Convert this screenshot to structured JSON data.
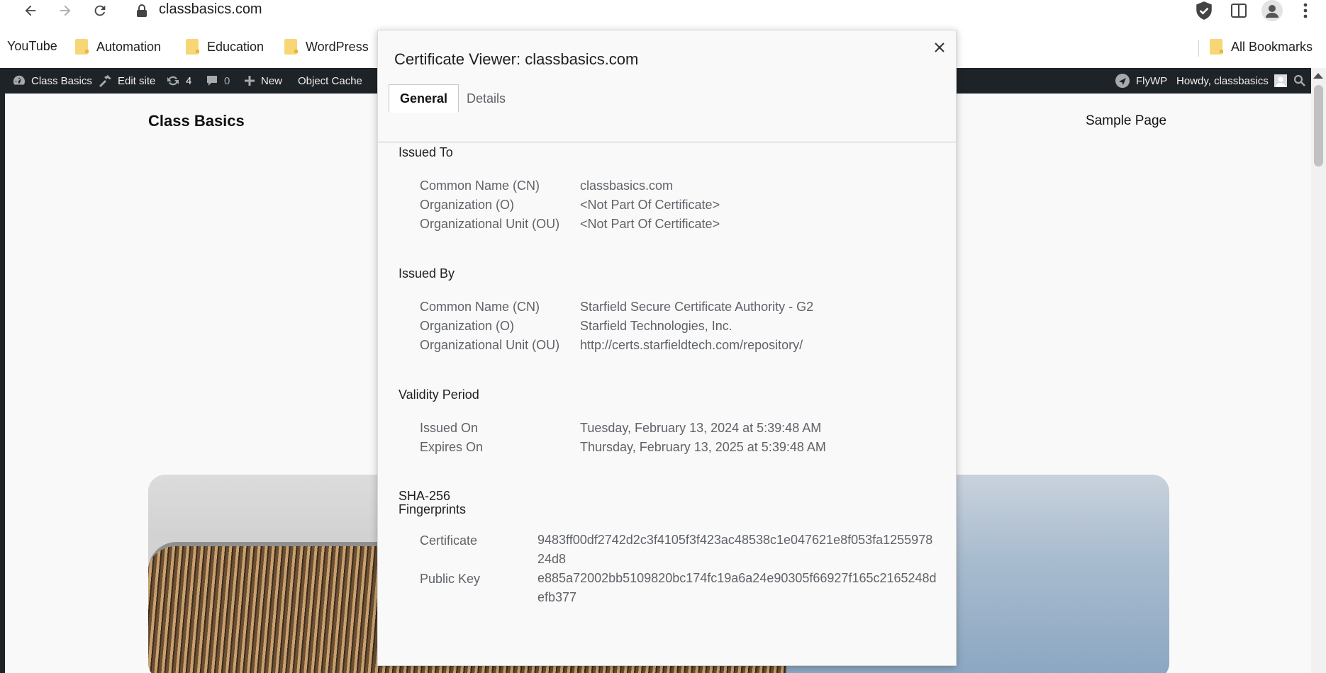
{
  "browser": {
    "url": "classbasics.com",
    "bookmarks": [
      {
        "label": "YouTube",
        "folder": false
      },
      {
        "label": "Automation",
        "folder": true
      },
      {
        "label": "Education",
        "folder": true
      },
      {
        "label": "WordPress",
        "folder": true
      }
    ],
    "all_bookmarks": "All Bookmarks"
  },
  "adminbar": {
    "site_name": "Class Basics",
    "edit_site": "Edit site",
    "updates_count": "4",
    "comments_count": "0",
    "new_label": "New",
    "object_cache": "Object Cache",
    "flywp": "FlyWP",
    "howdy": "Howdy, classbasics"
  },
  "site": {
    "title": "Class Basics",
    "nav_sample_page": "Sample Page"
  },
  "dialog": {
    "title": "Certificate Viewer: classbasics.com",
    "tabs": {
      "general": "General",
      "details": "Details"
    },
    "issued_to": {
      "heading": "Issued To",
      "cn_label": "Common Name (CN)",
      "cn_value": "classbasics.com",
      "o_label": "Organization (O)",
      "o_value": "<Not Part Of Certificate>",
      "ou_label": "Organizational Unit (OU)",
      "ou_value": "<Not Part Of Certificate>"
    },
    "issued_by": {
      "heading": "Issued By",
      "cn_label": "Common Name (CN)",
      "cn_value": "Starfield Secure Certificate Authority - G2",
      "o_label": "Organization (O)",
      "o_value": "Starfield Technologies, Inc.",
      "ou_label": "Organizational Unit (OU)",
      "ou_value": "http://certs.starfieldtech.com/repository/"
    },
    "validity": {
      "heading": "Validity Period",
      "issued_label": "Issued On",
      "issued_value": "Tuesday, February 13, 2024 at 5:39:48 AM",
      "expires_label": "Expires On",
      "expires_value": "Thursday, February 13, 2025 at 5:39:48 AM"
    },
    "fingerprints": {
      "heading_line1": "SHA-256",
      "heading_line2": "Fingerprints",
      "cert_label": "Certificate",
      "cert_value": "9483ff00df2742d2c3f4105f3f423ac48538c1e047621e8f053fa125597824d8",
      "pubkey_label": "Public Key",
      "pubkey_value": "e885a72002bb5109820bc174fc19a6a24e90305f66927f165c2165248defb377"
    }
  }
}
